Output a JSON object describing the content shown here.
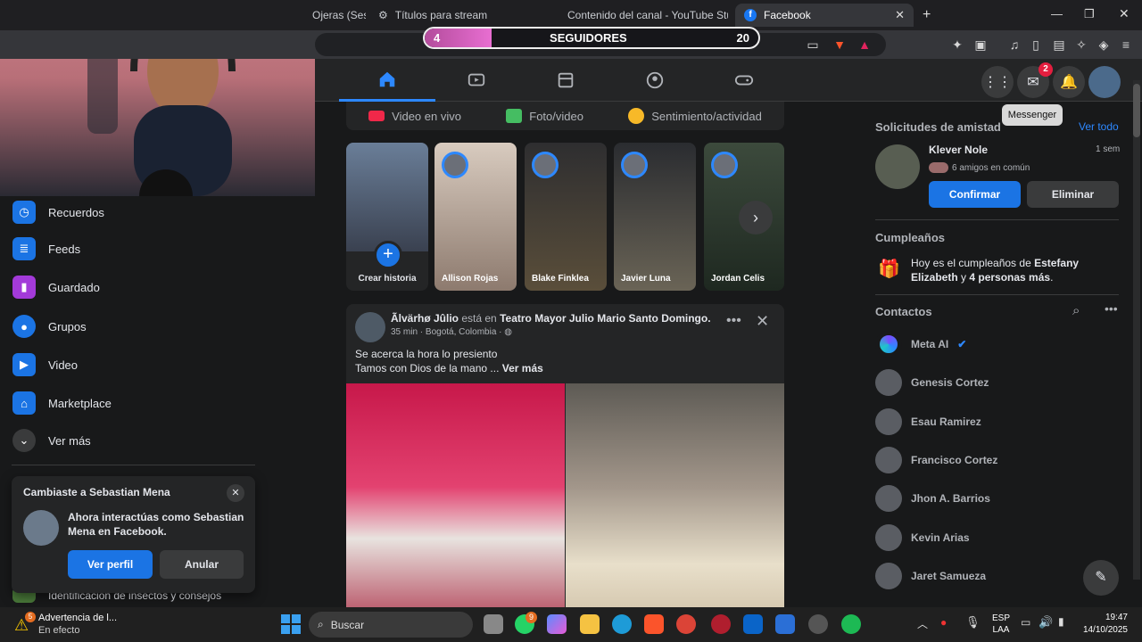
{
  "browser": {
    "tabs": [
      {
        "label": "Ojeras (Sesi"
      },
      {
        "label": "Títulos para stream"
      },
      {
        "label": "Contenido del canal - YouTube Studi"
      },
      {
        "label": "Facebook"
      }
    ],
    "followers_overlay": {
      "current": "4",
      "label": "SEGUIDORES",
      "goal": "20",
      "progress": 0.2
    }
  },
  "fbnav": {
    "messenger_badge": "2",
    "tooltip": "Messenger"
  },
  "composer": {
    "live": "Video en vivo",
    "photo": "Foto/video",
    "feeling": "Sentimiento/actividad"
  },
  "stories": [
    {
      "name": "Crear historia"
    },
    {
      "name": "Allison Rojas"
    },
    {
      "name": "Blake Finklea"
    },
    {
      "name": "Javier Luna"
    },
    {
      "name": "Jordan Celis"
    }
  ],
  "sidebar": {
    "items": [
      {
        "label": "Recuerdos",
        "icon": "clock-icon"
      },
      {
        "label": "Feeds",
        "icon": "feeds-icon"
      },
      {
        "label": "Guardado",
        "icon": "bookmark-icon"
      },
      {
        "label": "Grupos",
        "icon": "groups-icon"
      },
      {
        "label": "Video",
        "icon": "video-icon"
      },
      {
        "label": "Marketplace",
        "icon": "store-icon"
      },
      {
        "label": "Ver más",
        "icon": "chevron-down-icon"
      }
    ],
    "partial_item": "Identificación de insectos y consejos"
  },
  "toast": {
    "title": "Cambiaste a Sebastian Mena",
    "body": "Ahora interactúas como Sebastian Mena en Facebook.",
    "primary": "Ver perfil",
    "secondary": "Anular"
  },
  "post": {
    "author": "Ãlvärhø Jûlio",
    "action": "está en",
    "place": "Teatro Mayor Julio Mario Santo Domingo.",
    "meta": "35 min · Bogotá, Colombia ·",
    "line1": "Se acerca la hora lo presiento",
    "line2": "Tamos con Dios de la mano ...",
    "more": "Ver más"
  },
  "right": {
    "requests_title": "Solicitudes de amistad",
    "see_all": "Ver todo",
    "request": {
      "name": "Klever Nole",
      "time": "1 sem",
      "mutual": "6 amigos en común",
      "confirm": "Confirmar",
      "delete": "Eliminar"
    },
    "birthdays_title": "Cumpleaños",
    "birthday_pre": "Hoy es el cumpleaños de ",
    "birthday_name": "Estefany Elizabeth",
    "birthday_mid": " y ",
    "birthday_others": "4 personas más",
    "birthday_end": ".",
    "contacts_title": "Contactos",
    "contacts": [
      "Meta AI",
      "Genesis Cortez",
      "Esau Ramirez",
      "Francisco Cortez",
      "Jhon A. Barrios",
      "Kevin Arias",
      "Jaret Samueza"
    ]
  },
  "taskbar": {
    "notif_title": "Advertencia de l...",
    "notif_sub": "En efecto",
    "notif_badge": "5",
    "search": "Buscar",
    "whatsapp_badge": "9",
    "lang1": "ESP",
    "lang2": "LAA",
    "time": "19:47",
    "date": "14/10/2025"
  }
}
